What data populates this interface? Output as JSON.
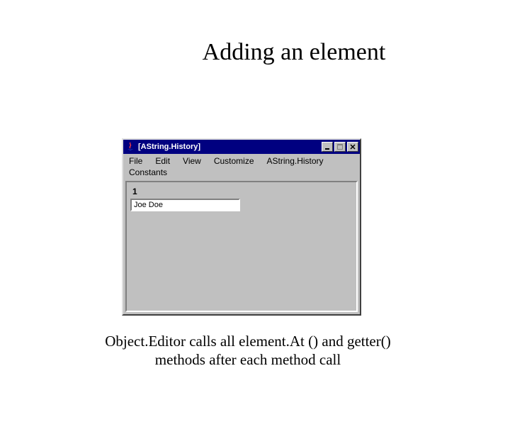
{
  "slide": {
    "title": "Adding an element",
    "caption_line1": "Object.Editor calls all element.At () and getter()",
    "caption_line2": "methods after each method call"
  },
  "window": {
    "title": "[AString.History]",
    "menu": {
      "file": "File",
      "edit": "Edit",
      "view": "View",
      "customize": "Customize",
      "history": "AString.History",
      "constants": "Constants"
    },
    "content": {
      "index_label": "1",
      "input_value": "Joe Doe"
    }
  }
}
